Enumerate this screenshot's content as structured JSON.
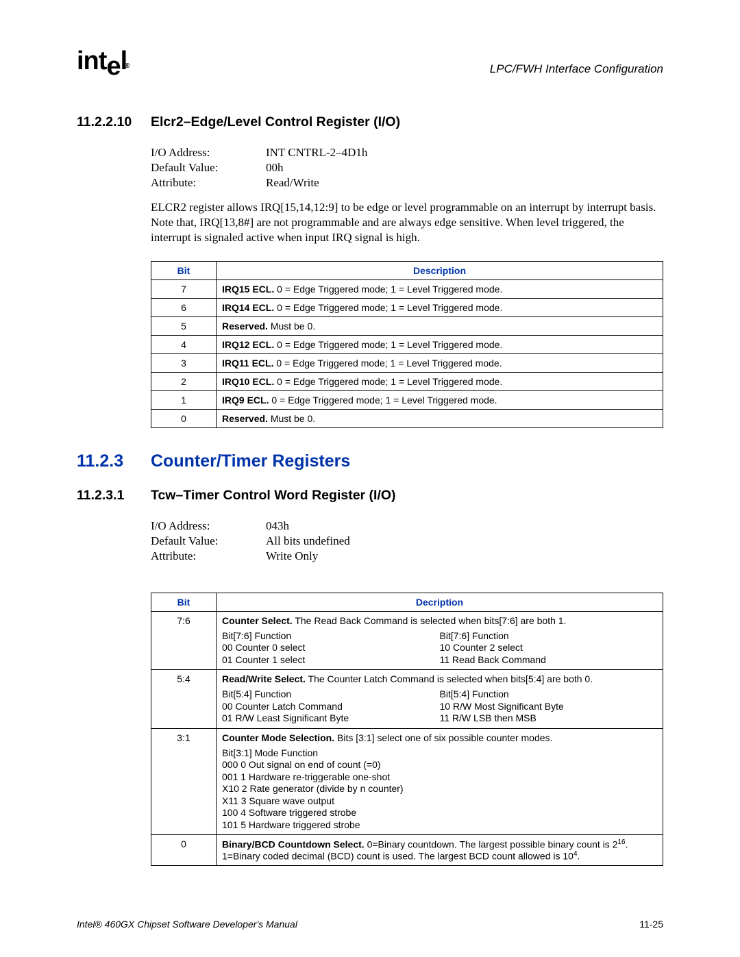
{
  "header": {
    "logo_part1": "int",
    "logo_drop": "e",
    "logo_part2": "l",
    "logo_reg": "®",
    "section_title": "LPC/FWH Interface Configuration"
  },
  "sec1": {
    "num": "11.2.2.10",
    "title": "Elcr2–Edge/Level Control Register (I/O)",
    "info": {
      "io_label": "I/O Address:",
      "io_value": "INT CNTRL-2–4D1h",
      "dv_label": "Default Value:",
      "dv_value": "00h",
      "attr_label": "Attribute:",
      "attr_value": "Read/Write"
    },
    "para": "ELCR2 register allows IRQ[15,14,12:9] to be edge or level programmable on an interrupt by interrupt basis. Note that, IRQ[13,8#] are not programmable and are always edge sensitive. When level triggered, the interrupt is signaled active when input IRQ signal is high.",
    "th_bit": "Bit",
    "th_desc": "Description",
    "rows": [
      {
        "bit": "7",
        "bold": "IRQ15 ECL.",
        "rest": " 0 = Edge Triggered mode; 1 = Level Triggered mode."
      },
      {
        "bit": "6",
        "bold": "IRQ14 ECL.",
        "rest": " 0 = Edge Triggered mode; 1 = Level Triggered mode."
      },
      {
        "bit": "5",
        "bold": "Reserved.",
        "rest": " Must be 0."
      },
      {
        "bit": "4",
        "bold": "IRQ12 ECL.",
        "rest": " 0 = Edge Triggered mode; 1 = Level Triggered mode."
      },
      {
        "bit": "3",
        "bold": "IRQ11 ECL.",
        "rest": " 0 = Edge Triggered mode; 1 = Level Triggered mode."
      },
      {
        "bit": "2",
        "bold": "IRQ10 ECL.",
        "rest": " 0 = Edge Triggered mode; 1 = Level Triggered mode."
      },
      {
        "bit": "1",
        "bold": "IRQ9 ECL.",
        "rest": " 0 = Edge Triggered mode; 1 = Level Triggered mode."
      },
      {
        "bit": "0",
        "bold": "Reserved.",
        "rest": " Must be 0."
      }
    ]
  },
  "sec2": {
    "num": "11.2.3",
    "title": "Counter/Timer Registers"
  },
  "sec3": {
    "num": "11.2.3.1",
    "title": "Tcw–Timer Control Word Register (I/O)",
    "info": {
      "io_label": "I/O Address:",
      "io_value": "043h",
      "dv_label": "Default Value:",
      "dv_value": "All bits undefined",
      "attr_label": "Attribute:",
      "attr_value": "Write Only"
    },
    "th_bit": "Bit",
    "th_desc": "Decription",
    "rows": {
      "r0": {
        "bit": "7:6",
        "bold": "Counter Select.",
        "rest": " The Read Back Command is selected when bits[7:6] are both 1.",
        "left": [
          "Bit[7:6] Function",
          "00 Counter 0 select",
          "01 Counter 1 select"
        ],
        "right": [
          "Bit[7:6] Function",
          "10 Counter 2 select",
          "11 Read Back Command"
        ]
      },
      "r1": {
        "bit": "5:4",
        "bold": "Read/Write Select.",
        "rest": " The Counter Latch Command is selected when bits[5:4] are both 0.",
        "left": [
          "Bit[5:4] Function",
          "00 Counter Latch Command",
          "01 R/W Least Significant Byte"
        ],
        "right": [
          "Bit[5:4] Function",
          "10 R/W Most Significant Byte",
          "11 R/W LSB then MSB"
        ]
      },
      "r2": {
        "bit": "3:1",
        "bold": "Counter Mode Selection.",
        "rest": " Bits [3:1] select one of six possible counter modes.",
        "lines": [
          "Bit[3:1] Mode Function",
          "000 0 Out signal on end of count (=0)",
          "001 1 Hardware re-triggerable one-shot",
          "X10 2 Rate generator (divide by n counter)",
          "X11 3 Square wave output",
          "100 4 Software triggered strobe",
          "101 5 Hardware triggered strobe"
        ]
      },
      "r3": {
        "bit": "0",
        "bold": "Binary/BCD Countdown Select.",
        "rest_a": " 0=Binary countdown. The largest possible binary count is 2",
        "sup_a": "16",
        "rest_b": ". 1=Binary coded decimal (BCD) count is used. The largest BCD count allowed is 10",
        "sup_b": "4",
        "rest_c": "."
      }
    }
  },
  "footer": {
    "left": "Intel® 460GX Chipset Software Developer's Manual",
    "right": "11-25"
  }
}
